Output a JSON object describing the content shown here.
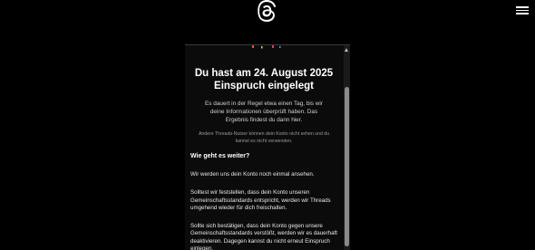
{
  "app": {
    "logo_icon": "threads-logo-icon",
    "menu_icon": "hamburger-menu-icon"
  },
  "dialog": {
    "title_line1": "Du hast am 24. August 2025",
    "title_line2": "Einspruch eingelegt",
    "lead": "Es dauert in der Regel etwa einen Tag, bis wir deine Informationen überprüft haben. Das Ergebnis findest du dann hier.",
    "note": "Andere Threads-Nutzer können dein Konto nicht sehen und du kannst es nicht verwenden.",
    "section_heading": "Wie geht es weiter?",
    "paragraphs": [
      "Wir werden uns dein Konto noch einmal ansehen.",
      "Solltest wir feststellen, dass dein Konto unseren Gemeinschaftsstandards entspricht, werden wir Threads umgehend wieder für dich freischalten.",
      "Sollte sich bestätigen, dass dein Konto gegen unsere Gemeinschaftsstandards verstößt, werden wir es dauerhaft deaktivieren. Dagegen kannst du nicht erneut Einspruch einlegen."
    ]
  },
  "colors": {
    "background": "#000000",
    "panel": "#0b0b0b",
    "text": "#ffffff"
  }
}
